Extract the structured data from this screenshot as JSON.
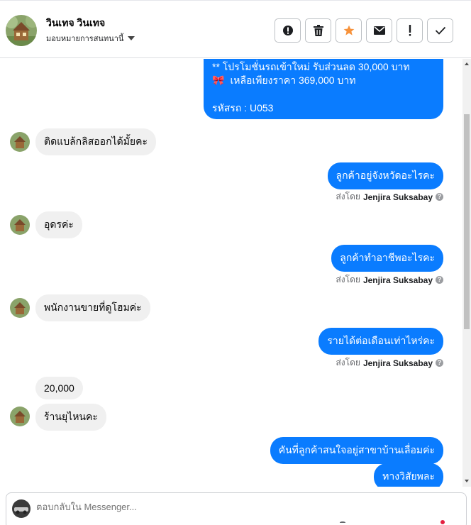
{
  "header": {
    "contact_name": "วินเทจ วินเทจ",
    "assign_label": "มอบหมายการสนทนานี้",
    "actions": [
      "alert-icon",
      "trash-icon",
      "star-icon",
      "envelope-icon",
      "exclamation-icon",
      "check-icon"
    ]
  },
  "colors": {
    "accent": "#0a7cff",
    "star": "#f7923b",
    "incoming": "#f0f0f0"
  },
  "promo": {
    "line1": "** โปรโมชั่นรถเข้าใหม่ รับส่วนลด 30,000 บาท",
    "line2": "เหลือเพียงราคา 369,000 บาท",
    "line3": "รหัสรถ : U053"
  },
  "messages": [
    {
      "dir": "in",
      "text": "ติดแบล้กลิสออกได้มั้ยคะ"
    },
    {
      "dir": "out",
      "text": "ลูกค้าอยู่จังหวัดอะไรคะ",
      "sent_by_prefix": "ส่งโดย",
      "sender": "Jenjira Suksabay"
    },
    {
      "dir": "in",
      "text": "อุดรค่ะ"
    },
    {
      "dir": "out",
      "text": "ลูกค้าทำอาชีพอะไรคะ",
      "sent_by_prefix": "ส่งโดย",
      "sender": "Jenjira Suksabay"
    },
    {
      "dir": "in",
      "text": "พนักงานขายที่ดูโฮมค่ะ"
    },
    {
      "dir": "out",
      "text": "รายได้ต่อเดือนเท่าไหร่คะ",
      "sent_by_prefix": "ส่งโดย",
      "sender": "Jenjira Suksabay"
    },
    {
      "dir": "in",
      "text": "20,000"
    },
    {
      "dir": "in",
      "text": "ร้านยุไหนคะ"
    },
    {
      "dir": "out",
      "text": "คันที่ลูกค้าสนใจอยู่สาขาบ้านเลื่อมค่ะ"
    },
    {
      "dir": "out",
      "text": "ทางวิสัยพละ"
    }
  ],
  "composer": {
    "placeholder": "ตอบกลับใน Messenger..."
  }
}
